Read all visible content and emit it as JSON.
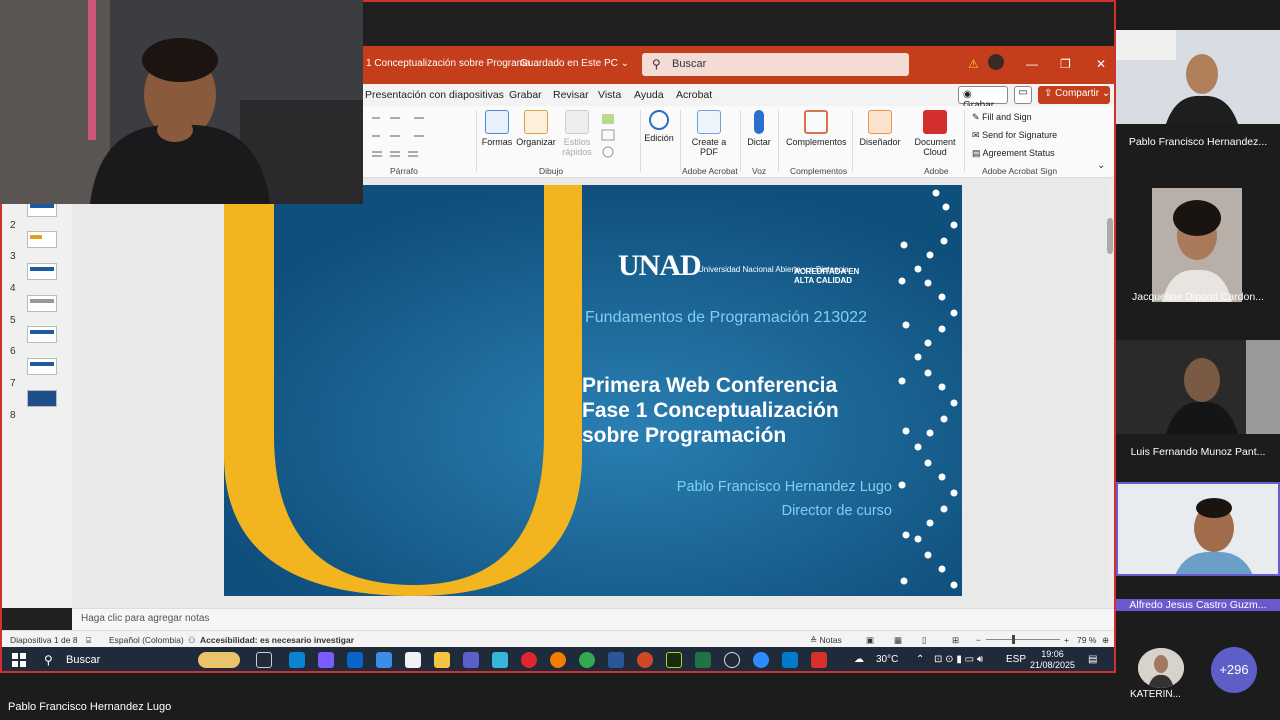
{
  "window": {
    "title": "1 Conceptualización sobre Programa...",
    "saved_status": "Guardado en Este PC",
    "search_placeholder": "Buscar"
  },
  "ribbon_tabs": [
    "Presentación con diapositivas",
    "Grabar",
    "Revisar",
    "Vista",
    "Ayuda",
    "Acrobat"
  ],
  "ribbon_actions": {
    "grabar": "Grabar",
    "compartir": "Compartir"
  },
  "ribbon": {
    "groups": {
      "parrafo": "Párrafo",
      "dibujo": "Dibujo",
      "adobe_acrobat": "Adobe Acrobat",
      "voz": "Voz",
      "complementos": "Complementos",
      "adobe": "Adobe",
      "adobe_acrobat_sign": "Adobe Acrobat Sign"
    },
    "buttons": {
      "formas": "Formas",
      "organizar": "Organizar",
      "estilos": "Estilos rápidos",
      "edicion": "Edición",
      "create_pdf": "Create a PDF",
      "dictar": "Dictar",
      "complementos": "Complementos",
      "disenador": "Diseñador",
      "document_cloud": "Document Cloud"
    },
    "acrobat_sign": [
      "Fill and Sign",
      "Send for Signature",
      "Agreement Status"
    ]
  },
  "slides": {
    "numbers": [
      "2",
      "3",
      "4",
      "5",
      "6",
      "7",
      "8"
    ]
  },
  "slide": {
    "logo_text": "UNAD",
    "university": "Universidad Nacional Abierta y a Distancia",
    "accreditation": "ACREDITADA EN ALTA CALIDAD",
    "course": "Fundamentos de Programación 213022",
    "title_line1": "Primera Web Conferencia",
    "title_line2": "Fase 1 Conceptualización",
    "title_line3": "sobre Programación",
    "author": "Pablo Francisco Hernandez Lugo",
    "role": "Director de curso",
    "colors": {
      "background": "#155e8d",
      "u_shape": "#f2b51f",
      "accent_text": "#7fd0f0"
    }
  },
  "notes_placeholder": "Haga clic para agregar notas",
  "status_bar": {
    "slide_of": "Diapositiva 1 de 8",
    "language": "Español (Colombia)",
    "accessibility": "Accesibilidad: es necesario investigar",
    "notes": "Notas",
    "zoom": "79 %"
  },
  "taskbar": {
    "search": "Buscar",
    "weather": "30°C",
    "lang": "ESP",
    "time": "19:06",
    "date": "21/08/2025"
  },
  "participants": {
    "presenter_label": "Pablo Francisco Hernandez Lugo",
    "tiles": [
      "Pablo Francisco Hernandez...",
      "Jacqueline Diponti Cardon...",
      "Luis Fernando Munoz Pant...",
      "Alfredo Jesus Castro Guzm..."
    ],
    "small": "KATERIN...",
    "more_count": "+296"
  }
}
